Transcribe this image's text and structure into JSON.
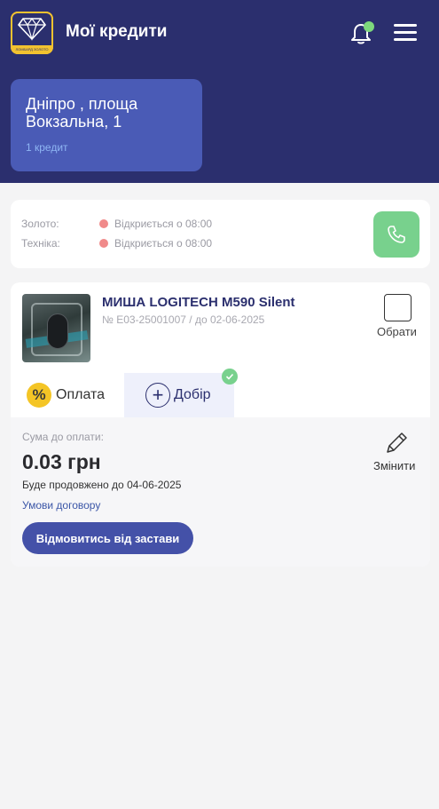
{
  "header": {
    "title": "Мої кредити",
    "logo_text": "ЛОМБАРД ЗОЛОТО",
    "bell_icon": "bell-icon",
    "menu_icon": "hamburger-menu-icon",
    "notification_dot_color": "#7dd87c",
    "background_color": "#2b2f6e"
  },
  "branch": {
    "name": "Дніпро , площа Вокзальна, 1",
    "count": "1 кредит",
    "card_color": "#4a5bb6"
  },
  "hours": {
    "rows": [
      {
        "label": "Золото:",
        "status": "Відкриється о 08:00"
      },
      {
        "label": "Техніка:",
        "status": "Відкриється о 08:00"
      }
    ],
    "status_dot_color": "#f08a8a",
    "phone_icon": "phone-icon",
    "phone_button_color": "#78d18d"
  },
  "loan": {
    "item_name": "МИША LOGITECH M590 Silent",
    "item_number": "№ Е03-25001007 / до 02-06-2025",
    "select_label": "Обрати",
    "tabs": {
      "payment": {
        "icon": "%",
        "label": "Оплата"
      },
      "extra": {
        "icon": "+",
        "label": "Добір"
      }
    },
    "payment": {
      "amount_label": "Сума до оплати:",
      "amount": "0.03 грн",
      "extended_until": "Буде продовжено до 04-06-2025",
      "terms_link": "Умови договору",
      "refuse_button": "Відмовитись від застави",
      "edit_label": "Змінити",
      "edit_icon": "pencil-icon"
    },
    "accent_color": "#4451a8",
    "payment_icon_color": "#f4c526"
  }
}
